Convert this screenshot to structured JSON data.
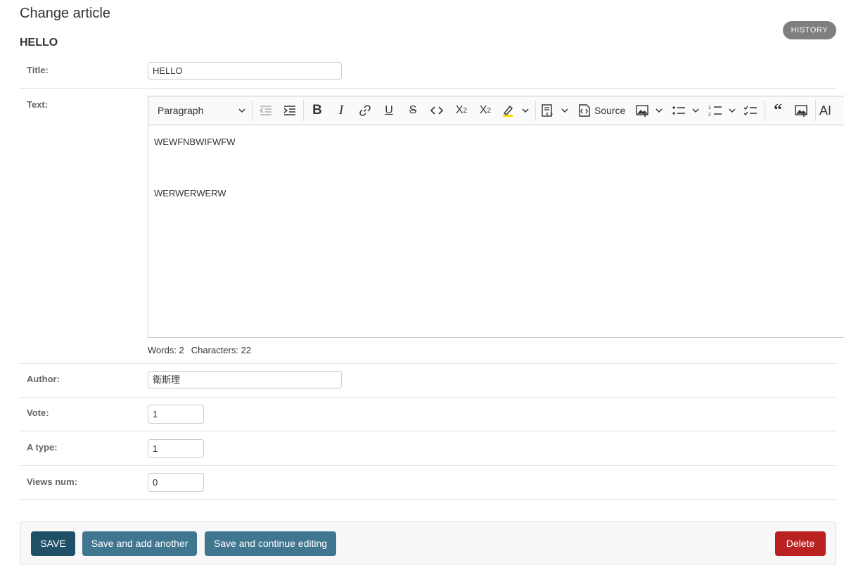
{
  "page": {
    "title": "Change article",
    "object_title": "HELLO",
    "history_label": "HISTORY"
  },
  "fields": {
    "title": {
      "label": "Title:",
      "value": "HELLO"
    },
    "text": {
      "label": "Text:"
    },
    "author": {
      "label": "Author:",
      "value": "衛斯理"
    },
    "vote": {
      "label": "Vote:",
      "value": "1"
    },
    "a_type": {
      "label": "A type:",
      "value": "1"
    },
    "views_num": {
      "label": "Views num:",
      "value": "0"
    }
  },
  "editor": {
    "heading_select": "Paragraph",
    "source_label": "Source",
    "paragraphs": [
      "WEWFNBWIFWFW",
      "WERWERWERW"
    ],
    "words": "Words: 2",
    "characters": "Characters: 22",
    "toolbar_icons": [
      "chevron-down-icon",
      "outdent-icon",
      "indent-icon",
      "bold-icon",
      "italic-icon",
      "link-icon",
      "underline-icon",
      "strikethrough-icon",
      "code-icon",
      "subscript-icon",
      "superscript-icon",
      "highlight-icon",
      "source-editing-icon",
      "image-insert-icon",
      "bulleted-list-icon",
      "numbered-list-icon",
      "todo-list-icon",
      "blockquote-icon",
      "image-upload-icon",
      "font-size-icon"
    ]
  },
  "submit": {
    "save": "SAVE",
    "save_add": "Save and add another",
    "save_continue": "Save and continue editing",
    "delete": "Delete"
  },
  "colors": {
    "primary": "#205067",
    "secondary": "#417690",
    "danger": "#ba2121",
    "history": "#7f7f7f"
  }
}
